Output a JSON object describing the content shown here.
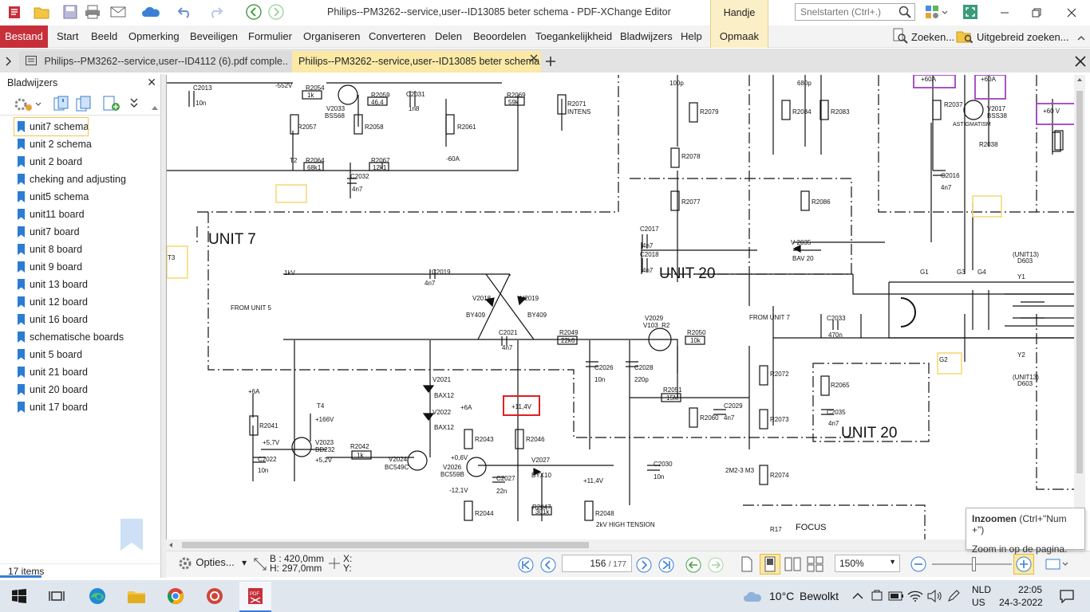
{
  "window": {
    "title": "Philips--PM3262--service,user--ID13085 beter schema - PDF-XChange Editor",
    "context_tab": "Handje",
    "search_placeholder": "Snelstarten (Ctrl+.)"
  },
  "menu": {
    "file": "Bestand",
    "items": [
      "Start",
      "Beeld",
      "Opmerking",
      "Beveiligen",
      "Formulier",
      "Organiseren",
      "Converteren",
      "Delen",
      "Beoordelen",
      "Toegankelijkheid",
      "Bladwijzers",
      "Help"
    ],
    "context_item": "Opmaak",
    "find": "Zoeken...",
    "advanced_find": "Uitgebreid zoeken..."
  },
  "tabs": [
    {
      "label": "Philips--PM3262--service,user--ID4112 (6).pdf comple..",
      "active": false
    },
    {
      "label": "Philips--PM3262--service,user--ID13085 beter schema",
      "active": true
    }
  ],
  "bookmarks_panel": {
    "title": "Bladwijzers",
    "items": [
      "unit7 schema",
      "unit 2 schema",
      "unit 2 board",
      "cheking and adjusting",
      "unit5 schema",
      "unit11 board",
      "unit7 board",
      " unit 8 board",
      "unit 9 board",
      "unit 13 board",
      "unit 12 board",
      "unit 16 board",
      "schematische boards",
      "unit 5 board",
      "unit 21 board",
      "unit 20 board",
      "unit 17 board"
    ],
    "selected_index": 0,
    "status": "17 items"
  },
  "schematic": {
    "labels": {
      "unit7": "UNIT 7",
      "unit20a": "UNIT 20",
      "unit20b": "UNIT 20",
      "from_unit5": "FROM UNIT 5",
      "from_unit7": "FROM UNIT 7",
      "focus": "FOCUS",
      "astigmatism": "ASTIGMATISM",
      "intens": "INTENS",
      "hv": "2kV HIGH TENSION",
      "highlighted": "+11,4V",
      "r2054": "R2054",
      "r2057": "R2057",
      "r2058": "R2058",
      "r2059": "R2059",
      "r2061": "R2061",
      "r2064": "R2064",
      "r2067": "R2067",
      "r2069": "R2069",
      "r2071": "R2071",
      "r2079": "R2079",
      "r2078": "R2078",
      "r2077": "R2077",
      "r2084": "R2084",
      "r2083": "R2083",
      "r2086": "R2086",
      "r2037": "R2037",
      "r2038": "R2038",
      "r2041": "R2041",
      "r2042": "R2042",
      "r2043": "R2043",
      "r2044": "R2044",
      "r2046": "R2046",
      "r2047": "R2047",
      "r2048": "R2048",
      "r2049": "R2049",
      "r2050": "R2050",
      "r2051": "R2051",
      "r2060": "R2060",
      "r2065": "R2065",
      "r2072": "R2072",
      "r2073": "R2073",
      "r2074": "R2074",
      "c2013": "C2013",
      "c2031": "C2031",
      "c2032": "C2032",
      "c2017": "C2017",
      "c2018": "C2018",
      "c2016": "C2016",
      "c2019": "C2019",
      "c2021": "C2021",
      "c2022": "C2022",
      "c2026": "C2026",
      "c2027": "C2027",
      "c2028": "C2028",
      "c2029": "C2029",
      "c2030": "C2030",
      "c2033": "C2033",
      "c2035": "C2035",
      "v2033": "V2033",
      "v2017": "V2017",
      "v2018": "V2018",
      "v2019": "V2019",
      "v2021": "V2021",
      "v2022": "V2022",
      "v2023": "V2023",
      "v2024": "V2024",
      "v2026": "V2026",
      "v2027": "V2027",
      "v2029": "V2029",
      "v2035": "V 2035",
      "bss68": "BSS68",
      "bss38": "BSS38",
      "by409a": "BY409",
      "by409b": "BY409",
      "bax12a": "BAX12",
      "bax12b": "BAX12",
      "bd232": "BD232",
      "bc549c": "BC549C",
      "bc559b": "BC559B",
      "byx10": "BYX10",
      "bav20": "BAV 20",
      "v103": "V103_R2",
      "one_kv": "1kV",
      "plus6a": "+6A",
      "plus6b": "+6A",
      "plus166": "+166V",
      "plus57": "+5,7V",
      "plus52": "+5,2V",
      "plus114": "+11,4V",
      "plus06": "+0,6V",
      "minus121": "-12,1V",
      "minus60": "-60A",
      "minus552": "-552V",
      "plus60a": "+60A",
      "plus60b": "+60A",
      "plus60v": "+60 V",
      "t2": "T2",
      "t3": "T3",
      "t4": "T4",
      "g1": "G1",
      "g2": "G2",
      "g3": "G3",
      "g4": "G4",
      "y1": "Y1",
      "y2": "Y2",
      "unit13": "(UNIT13)",
      "d603a": "D603",
      "unit13b": "(UNIT13)",
      "d603b": "D603",
      "r2054v": "1k",
      "r2059v": "46,4",
      "r2064v": "68k1",
      "r2067v": "12k1",
      "r2069v": "59k",
      "r2049v": "22k6",
      "r2050v": "10k",
      "r2051v": "15M",
      "r2042v": "1k",
      "r2047v": "301k",
      "c2013v": "10n",
      "c2031v": "1n8",
      "c2032v": "4n7",
      "c2017v": "4n7",
      "c2018v": "4n7",
      "c2016v": "4n7",
      "c2019v": "4n7",
      "c2021v": "4n7",
      "c2022v": "10n",
      "c2026v": "10n",
      "c2027v": "22n",
      "c2028v": "220p",
      "c2029v": "4n7",
      "c2030v": "10n",
      "c2033v": "470n",
      "c2035v": "4n7",
      "c100p": "100p",
      "c680p": "680p",
      "hm23": "2M2-3 M3",
      "r17": "R17"
    }
  },
  "bottom": {
    "options": "Opties...",
    "size_w": "B : 420,0mm",
    "size_h": "H: 297,0mm",
    "coord_x": "X:",
    "coord_y": "Y:",
    "page_current": "156",
    "page_total": "/ 177",
    "zoom": "150%"
  },
  "tooltip": {
    "title": "Inzoomen",
    "shortcut": "(Ctrl+\"Num +\")",
    "desc": "Zoom in op de pagina."
  },
  "taskbar": {
    "temp": "10°C",
    "weather": "Bewolkt",
    "lang1": "NLD",
    "lang2": "US",
    "time": "22:05",
    "date": "24-3-2022"
  },
  "colors": {
    "accent_red": "#c7303a",
    "tab_yellow": "#fbe9a5",
    "bookmark_blue": "#2b7cd3",
    "highlight_red": "#e02020",
    "highlight_yellow": "#f5d76e",
    "highlight_purple": "#a040c0"
  }
}
